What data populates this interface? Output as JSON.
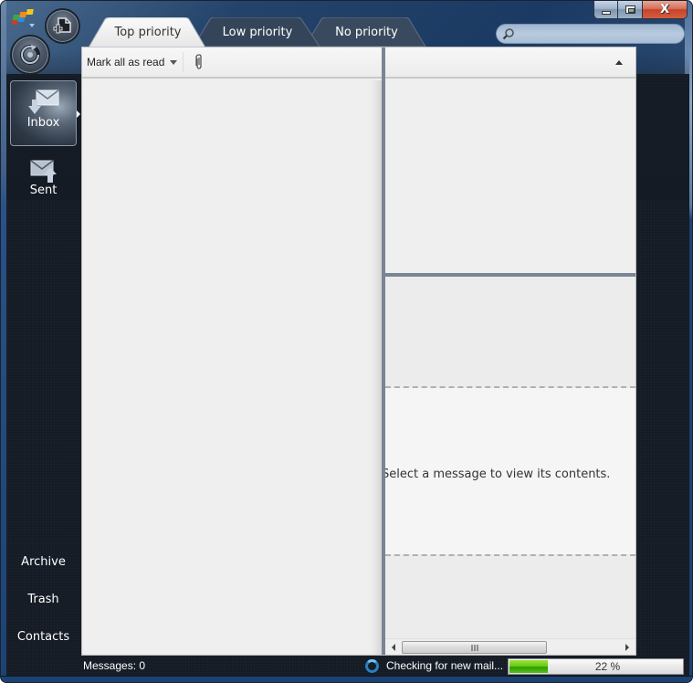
{
  "window": {
    "caption_buttons": {
      "minimize": "minimize-icon",
      "maximize": "maximize-icon",
      "close": "close-icon",
      "close_glyph": "X"
    },
    "accent_color": "#1d4272"
  },
  "toolbar": {
    "new_button_icon": "new-message-icon",
    "refresh_button_icon": "refresh-icon",
    "app_menu_icon": "app-menu-icon"
  },
  "tabs": [
    {
      "label": "Top priority",
      "active": true
    },
    {
      "label": "Low priority",
      "active": false
    },
    {
      "label": "No priority",
      "active": false
    }
  ],
  "search": {
    "placeholder": "",
    "value": "",
    "icon": "search-icon"
  },
  "sidebar": {
    "items": [
      {
        "label": "Inbox",
        "icon": "inbox-icon",
        "selected": true
      },
      {
        "label": "Sent",
        "icon": "sent-icon",
        "selected": false
      }
    ],
    "bottom_items": [
      {
        "label": "Archive"
      },
      {
        "label": "Trash"
      },
      {
        "label": "Contacts"
      }
    ]
  },
  "message_list": {
    "mark_all_read_label": "Mark all as read",
    "attachment_icon": "paperclip-icon",
    "dropdown_icon": "chevron-down-icon"
  },
  "preview": {
    "empty_message": "Select a message to view its contents.",
    "collapse_icon": "collapse-up-icon"
  },
  "status_bar": {
    "messages_label": "Messages: 0",
    "checking_label": "Checking for new mail...",
    "progress_percent": 22,
    "progress_label": "22 %",
    "progress_color": "#6ccc10"
  }
}
